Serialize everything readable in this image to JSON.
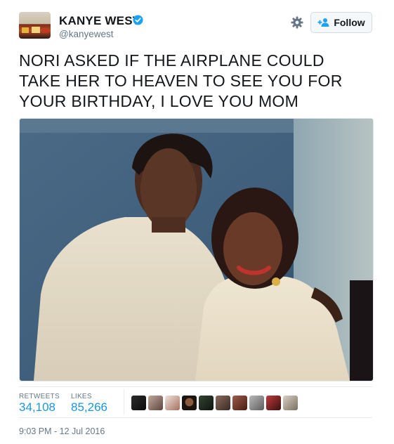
{
  "user": {
    "name": "KANYE WEST",
    "handle": "@kanyewest",
    "verified": true,
    "avatar_icon": "avatar-image"
  },
  "actions": {
    "settings_icon": "gear-icon",
    "follow_label": "Follow",
    "follow_icon": "add-user-icon"
  },
  "tweet": {
    "text_lines": [
      "NORI ASKED IF THE AIRPLANE COULD",
      "TAKE HER TO HEAVEN TO SEE YOU FOR",
      "YOUR BIRTHDAY, I LOVE YOU MOM"
    ],
    "photo_icon": "photo-image"
  },
  "stats": {
    "retweets_label": "RETWEETS",
    "retweets_value": "34,108",
    "likes_label": "LIKES",
    "likes_value": "85,266",
    "likers_count": 10
  },
  "timestamp": "9:03 PM - 12 Jul 2016",
  "colors": {
    "link_blue": "#1b95e0",
    "verified_blue": "#1da1f2",
    "secondary_text": "#657786",
    "primary_text": "#14171a"
  }
}
